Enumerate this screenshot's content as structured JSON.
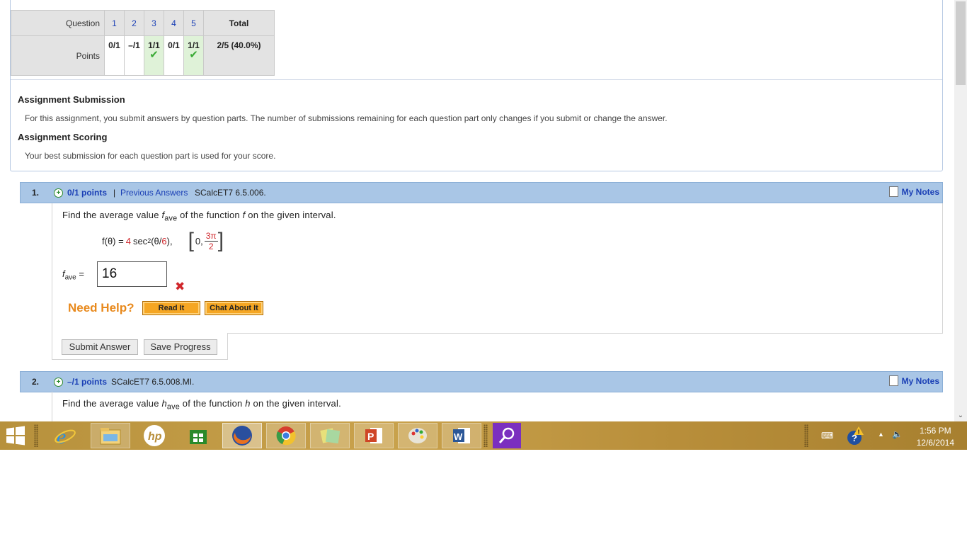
{
  "summary": {
    "question_label": "Question",
    "points_label": "Points",
    "total_label": "Total",
    "questions": [
      {
        "num": "1",
        "points": "0/1",
        "correct": false
      },
      {
        "num": "2",
        "points": "–/1",
        "correct": false
      },
      {
        "num": "3",
        "points": "1/1",
        "correct": true
      },
      {
        "num": "4",
        "points": "0/1",
        "correct": false
      },
      {
        "num": "5",
        "points": "1/1",
        "correct": true
      }
    ],
    "total_value": "2/5 (40.0%)",
    "submission_title": "Assignment Submission",
    "submission_text": "For this assignment, you submit answers by question parts. The number of submissions remaining for each question part only changes if you submit or change the answer.",
    "scoring_title": "Assignment Scoring",
    "scoring_text": "Your best submission for each question part is used for your score."
  },
  "q1": {
    "number": "1.",
    "points": "0/1 points",
    "separator": "|",
    "previous_answers": "Previous Answers",
    "code": "SCalcET7 6.5.006.",
    "my_notes": "My Notes",
    "prompt_pre": "Find the average value ",
    "prompt_var": "f",
    "prompt_sub": "ave",
    "prompt_post_a": " of the function ",
    "prompt_func": "f",
    "prompt_post_b": " on the given interval.",
    "formula": {
      "lhs": "f(θ) = ",
      "coef": "4",
      "sec": " sec",
      "sq": "2",
      "arg_open": "(θ/",
      "arg_den": "6",
      "arg_close": "),",
      "interval_start": "0,",
      "interval_num": "3π",
      "interval_den": "2"
    },
    "answer_label_var": "f",
    "answer_label_sub": "ave",
    "answer_label_eq": " =",
    "answer_value": "16",
    "wrong_mark": "✖",
    "need_help": "Need Help?",
    "read_it": "Read It",
    "chat_about_it": "Chat About It",
    "submit_answer": "Submit Answer",
    "save_progress": "Save Progress"
  },
  "q2": {
    "number": "2.",
    "points": "–/1 points",
    "code": "SCalcET7 6.5.008.MI.",
    "my_notes": "My Notes",
    "prompt_pre": "Find the average value ",
    "prompt_var": "h",
    "prompt_sub": "ave",
    "prompt_post_a": " of the function ",
    "prompt_func": "h",
    "prompt_post_b": " on the given interval."
  },
  "taskbar": {
    "apps": [
      "start-icon",
      "internet-explorer-icon",
      "file-explorer-icon",
      "hp-icon",
      "store-icon",
      "firefox-icon",
      "chrome-icon",
      "sticky-notes-icon",
      "powerpoint-icon",
      "paint-icon",
      "word-icon",
      "magnifier-icon"
    ],
    "time": "1:56 PM",
    "date": "12/6/2014"
  },
  "colors": {
    "question_bar": "#a9c6e6",
    "link": "#1a3fb5",
    "error_red": "#d0262b",
    "help_orange": "#e8891c",
    "correct_green": "#3aaa35"
  }
}
